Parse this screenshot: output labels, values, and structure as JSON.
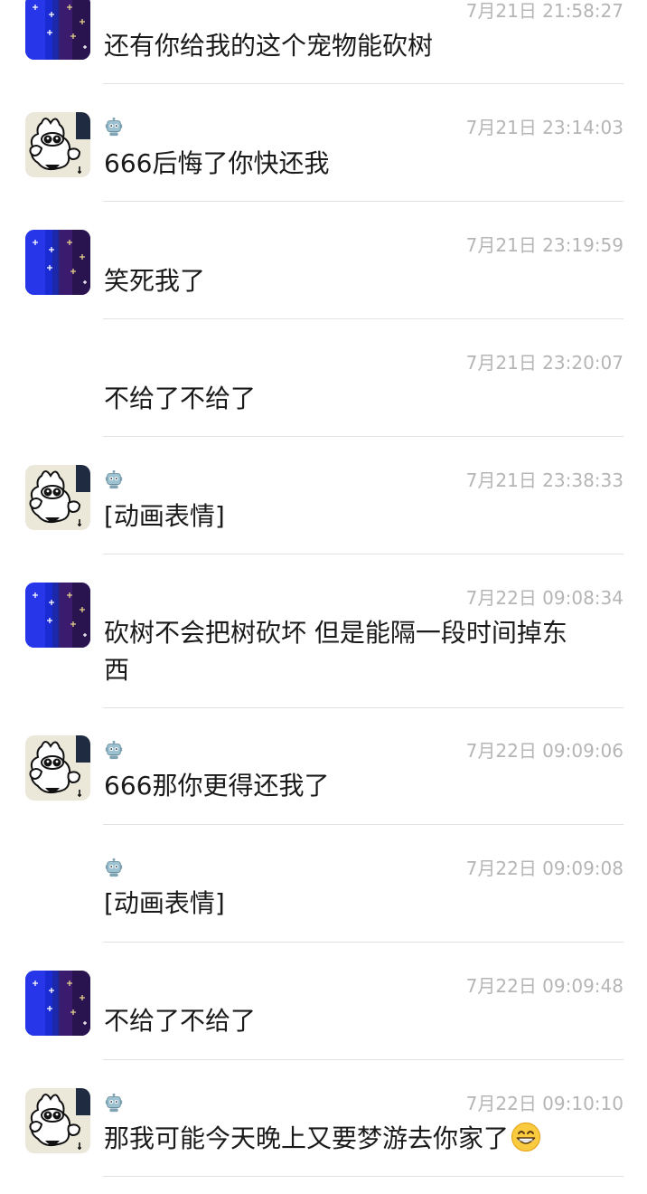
{
  "messages": [
    {
      "sender": "a",
      "name": "",
      "time": "7月21日 21:58:27",
      "text": "还有你给我的这个宠物能砍树"
    },
    {
      "sender": "b",
      "name": "",
      "time": "7月21日 23:14:03",
      "text": "666后悔了你快还我"
    },
    {
      "sender": "a",
      "name": "",
      "time": "7月21日 23:19:59",
      "text": "笑死我了"
    },
    {
      "sender": "a",
      "name": "",
      "time": "7月21日 23:20:07",
      "text": "不给了不给了"
    },
    {
      "sender": "b",
      "name": "",
      "time": "7月21日 23:38:33",
      "text": "[动画表情]"
    },
    {
      "sender": "a",
      "name": "",
      "time": "7月22日 09:08:34",
      "text_line1": "砍树不会把树砍坏 但是能隔一段时间掉东",
      "text_line2": "西"
    },
    {
      "sender": "b",
      "name": "",
      "time": "7月22日 09:09:06",
      "text": "666那你更得还我了"
    },
    {
      "sender": "b",
      "name": "",
      "time": "7月22日 09:09:08",
      "text": "[动画表情]"
    },
    {
      "sender": "a",
      "name": "",
      "time": "7月22日 09:09:48",
      "text": "不给了不给了"
    },
    {
      "sender": "b",
      "name": "",
      "time": "7月22日 09:10:10",
      "text": "那我可能今天晚上又要梦游去你家了",
      "emoji": "grinning-face"
    }
  ]
}
